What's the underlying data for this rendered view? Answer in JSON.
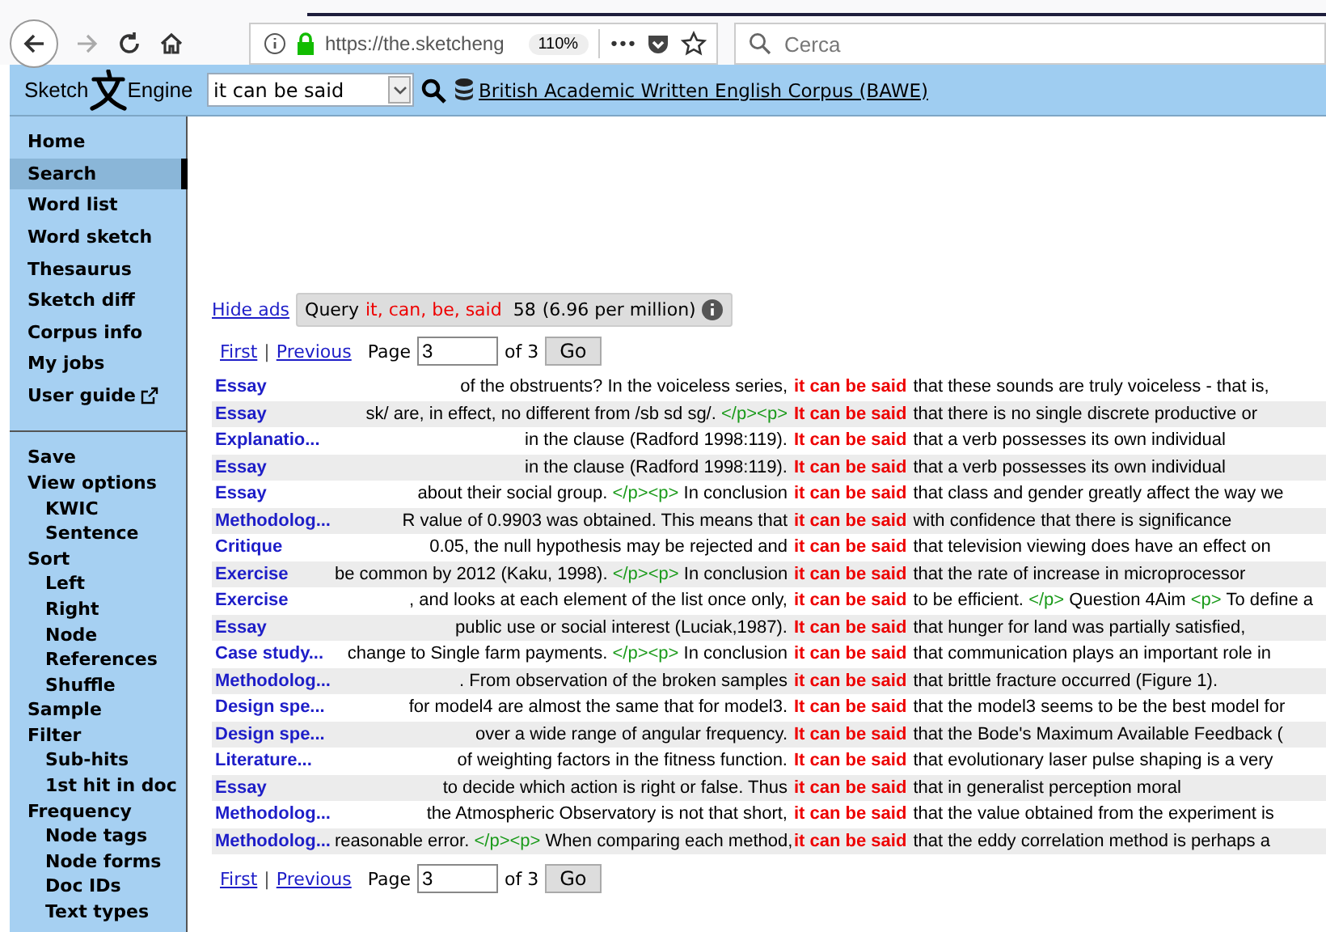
{
  "browser": {
    "url": "https://the.sketcheng",
    "zoom": "110%",
    "menu": "•••",
    "search_placeholder": "Cerca"
  },
  "header": {
    "logo_left": "Sketch",
    "logo_right": "Engine",
    "query": "it can be said",
    "corpus": "British Academic Written English Corpus (BAWE)"
  },
  "sidebar": {
    "main": [
      {
        "label": "Home",
        "selected": false,
        "kind": "link"
      },
      {
        "label": "Search",
        "selected": true,
        "kind": "link"
      },
      {
        "label": "Word list",
        "selected": false,
        "kind": "link"
      },
      {
        "label": "Word sketch",
        "selected": false,
        "kind": "link"
      },
      {
        "label": "Thesaurus",
        "selected": false,
        "kind": "link"
      },
      {
        "label": "Sketch diff",
        "selected": false,
        "kind": "link"
      },
      {
        "label": "Corpus info",
        "selected": false,
        "kind": "link"
      },
      {
        "label": "My jobs",
        "selected": false,
        "kind": "link"
      },
      {
        "label": "User guide",
        "selected": false,
        "kind": "external"
      }
    ],
    "tools": [
      {
        "label": "Save"
      },
      {
        "label": "View options",
        "children": [
          {
            "label": "KWIC"
          },
          {
            "label": "Sentence"
          }
        ]
      },
      {
        "label": "Sort",
        "children": [
          {
            "label": "Left"
          },
          {
            "label": "Right"
          },
          {
            "label": "Node"
          },
          {
            "label": "References"
          },
          {
            "label": "Shuffle"
          }
        ]
      },
      {
        "label": "Sample"
      },
      {
        "label": "Filter",
        "children": [
          {
            "label": "Sub-hits"
          },
          {
            "label": "1st hit in doc"
          }
        ]
      },
      {
        "label": "Frequency",
        "children": [
          {
            "label": "Node tags"
          },
          {
            "label": "Node forms"
          },
          {
            "label": "Doc IDs"
          },
          {
            "label": "Text types"
          }
        ]
      }
    ]
  },
  "hide_ads": "Hide ads",
  "query_summary": {
    "label": "Query",
    "terms": "it, can, be, said",
    "count": "58",
    "rate": "(6.96 per million)"
  },
  "pager_top": {
    "first": "First",
    "separator": "|",
    "previous": "Previous",
    "page_label": "Page",
    "page": "3",
    "of": "of 3",
    "go": "Go"
  },
  "lines": [
    {
      "ref": "Essay",
      "left": [
        {
          "kind": "text",
          "text": "of the obstruents? In the voiceless series,"
        }
      ],
      "kwic": "it can be said",
      "right": [
        {
          "kind": "text",
          "text": "that these sounds are truly voiceless - that is,"
        }
      ]
    },
    {
      "ref": "Essay",
      "left": [
        {
          "kind": "text",
          "text": "sk/ are, in effect, no different from /sb sd sg/."
        },
        {
          "kind": "tag",
          "text": "</p><p>"
        }
      ],
      "kwic": "It can be said",
      "right": [
        {
          "kind": "text",
          "text": "that there is no single discrete productive or"
        }
      ]
    },
    {
      "ref": "Explanatio...",
      "left": [
        {
          "kind": "text",
          "text": "in the clause (Radford 1998:119)."
        }
      ],
      "kwic": "It can be said",
      "right": [
        {
          "kind": "text",
          "text": "that a verb possesses its own individual"
        }
      ]
    },
    {
      "ref": "Essay",
      "left": [
        {
          "kind": "text",
          "text": "in the clause (Radford 1998:119)."
        }
      ],
      "kwic": "It can be said",
      "right": [
        {
          "kind": "text",
          "text": "that a verb possesses its own individual"
        }
      ]
    },
    {
      "ref": "Essay",
      "left": [
        {
          "kind": "text",
          "text": "about their social group."
        },
        {
          "kind": "tag",
          "text": "</p><p>"
        },
        {
          "kind": "text",
          "text": "In conclusion"
        }
      ],
      "kwic": "it can be said",
      "right": [
        {
          "kind": "text",
          "text": "that class and gender greatly affect the way we"
        }
      ]
    },
    {
      "ref": "Methodolog...",
      "left": [
        {
          "kind": "text",
          "text": "R value of 0.9903 was obtained. This means that"
        }
      ],
      "kwic": "it can be said",
      "right": [
        {
          "kind": "text",
          "text": "with confidence that there is significance"
        }
      ]
    },
    {
      "ref": "Critique",
      "left": [
        {
          "kind": "text",
          "text": "0.05, the null hypothesis may be rejected and"
        }
      ],
      "kwic": "it can be said",
      "right": [
        {
          "kind": "text",
          "text": "that television viewing does have an effect on"
        }
      ]
    },
    {
      "ref": "Exercise",
      "left": [
        {
          "kind": "text",
          "text": "be common by 2012 (Kaku, 1998)."
        },
        {
          "kind": "tag",
          "text": "</p><p>"
        },
        {
          "kind": "text",
          "text": "In conclusion"
        }
      ],
      "kwic": "it can be said",
      "right": [
        {
          "kind": "text",
          "text": "that the rate of increase in microprocessor"
        }
      ]
    },
    {
      "ref": "Exercise",
      "left": [
        {
          "kind": "text",
          "text": ", and looks at each element of the list once only,"
        }
      ],
      "kwic": "it can be said",
      "right": [
        {
          "kind": "text",
          "text": "to be efficient."
        },
        {
          "kind": "tag",
          "text": "</p>"
        },
        {
          "kind": "text",
          "text": "Question 4Aim"
        },
        {
          "kind": "tag",
          "text": "<p>"
        },
        {
          "kind": "text",
          "text": "To define a"
        }
      ]
    },
    {
      "ref": "Essay",
      "left": [
        {
          "kind": "text",
          "text": "public use or social interest (Luciak,1987)."
        }
      ],
      "kwic": "It can be said",
      "right": [
        {
          "kind": "text",
          "text": "that hunger for land was partially satisfied,"
        }
      ]
    },
    {
      "ref": "Case study...",
      "left": [
        {
          "kind": "text",
          "text": "change to Single farm payments."
        },
        {
          "kind": "tag",
          "text": "</p><p>"
        },
        {
          "kind": "text",
          "text": "In conclusion"
        }
      ],
      "kwic": "it can be said",
      "right": [
        {
          "kind": "text",
          "text": "that communication plays an important role in"
        }
      ]
    },
    {
      "ref": "Methodolog...",
      "left": [
        {
          "kind": "text",
          "text": ". From observation of the broken samples"
        }
      ],
      "kwic": "it can be said",
      "right": [
        {
          "kind": "text",
          "text": "that brittle fracture occurred (Figure 1)."
        }
      ]
    },
    {
      "ref": "Design spe...",
      "left": [
        {
          "kind": "text",
          "text": "for model4 are almost the same that for model3."
        }
      ],
      "kwic": "It can be said",
      "right": [
        {
          "kind": "text",
          "text": "that the model3 seems to be the best model for"
        }
      ]
    },
    {
      "ref": "Design spe...",
      "left": [
        {
          "kind": "text",
          "text": "over a wide range of angular frequency."
        }
      ],
      "kwic": "It can be said",
      "right": [
        {
          "kind": "text",
          "text": "that the Bode's Maximum Available Feedback ("
        }
      ]
    },
    {
      "ref": "Literature...",
      "left": [
        {
          "kind": "text",
          "text": "of weighting factors in the fitness function."
        }
      ],
      "kwic": "It can be said",
      "right": [
        {
          "kind": "text",
          "text": "that evolutionary laser pulse shaping is a very"
        }
      ]
    },
    {
      "ref": "Essay",
      "left": [
        {
          "kind": "text",
          "text": "to decide which action is right or false. Thus"
        }
      ],
      "kwic": "it can be said",
      "right": [
        {
          "kind": "text",
          "text": "that in generalist perception moral"
        }
      ]
    },
    {
      "ref": "Methodolog...",
      "left": [
        {
          "kind": "text",
          "text": "the Atmospheric Observatory is not that short,"
        }
      ],
      "kwic": "it can be said",
      "right": [
        {
          "kind": "text",
          "text": "that the value obtained from the experiment is"
        }
      ]
    },
    {
      "ref": "Methodolog...",
      "left": [
        {
          "kind": "text",
          "text": "reasonable error."
        },
        {
          "kind": "tag",
          "text": "</p><p>"
        },
        {
          "kind": "text",
          "text": "When comparing each method,"
        }
      ],
      "kwic": "it can be said",
      "right": [
        {
          "kind": "text",
          "text": "that the eddy correlation method is perhaps a"
        }
      ]
    }
  ],
  "pager_bottom": {
    "first": "First",
    "separator": "|",
    "previous": "Previous",
    "page_label": "Page",
    "page": "3",
    "of": "of 3",
    "go": "Go"
  }
}
